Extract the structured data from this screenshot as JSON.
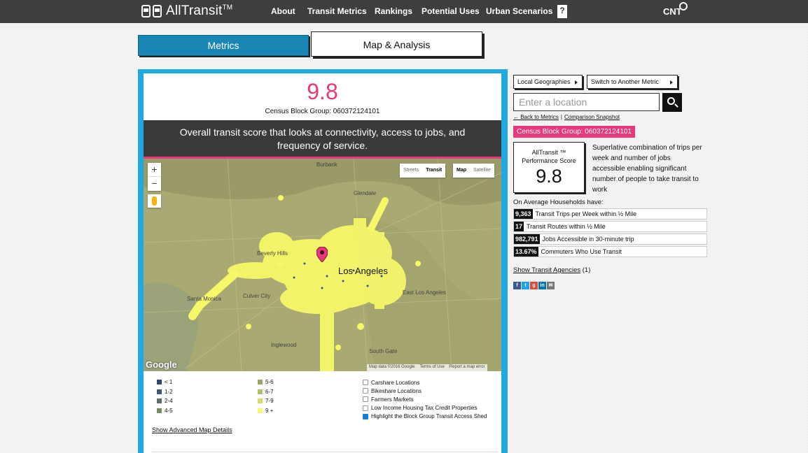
{
  "header": {
    "logo_text": "AllTransit",
    "logo_tm": "TM",
    "nav": [
      "About",
      "Transit Metrics",
      "Rankings",
      "Potential Uses",
      "Urban Scenarios"
    ],
    "help_icon": "?",
    "partner_logo": "CNT"
  },
  "tabs": {
    "metrics": "Metrics",
    "map_analysis": "Map & Analysis"
  },
  "score_panel": {
    "score": "9.8",
    "census_block_group": "Census Block Group: 060372124101",
    "description": "Overall transit score that looks at connectivity, access to jobs, and frequency of service."
  },
  "map": {
    "zoom_in": "+",
    "zoom_out": "−",
    "layer_streets": "Streets",
    "layer_transit": "Transit",
    "type_map": "Map",
    "type_satellite": "Satellite",
    "city_label": "Los Angeles",
    "place_labels": [
      "Burbank",
      "Glendale",
      "Beverly Hills",
      "Santa Monica",
      "Culver City",
      "Inglewood",
      "South Gate",
      "East Los Angeles"
    ],
    "google_logo": "Google",
    "attribution": [
      "Map data ©2016 Google",
      "Terms of Use",
      "Report a map error"
    ],
    "highlight_color": "#f7f76a",
    "base_color": "#a9a973"
  },
  "legend": {
    "left": [
      {
        "label": "< 1",
        "color": "#2d4a6e"
      },
      {
        "label": "1-2",
        "color": "#3e5a72"
      },
      {
        "label": "2-4",
        "color": "#5a6e6a"
      },
      {
        "label": "4-5",
        "color": "#7a8a63"
      }
    ],
    "right": [
      {
        "label": "5-6",
        "color": "#98a46a"
      },
      {
        "label": "6-7",
        "color": "#b4bd6c"
      },
      {
        "label": "7-9",
        "color": "#d6db6e"
      },
      {
        "label": "9 +",
        "color": "#f7f76a"
      }
    ]
  },
  "overlays": [
    {
      "label": "Carshare Locations",
      "checked": false
    },
    {
      "label": "Bikeshare Locations",
      "checked": false
    },
    {
      "label": "Farmers Markets",
      "checked": false
    },
    {
      "label": "Low Income Housing Tax Credit Properties",
      "checked": false
    },
    {
      "label": "Highlight the Block Group Transit Access Shed",
      "checked": true
    }
  ],
  "advanced_link": "Show Advanced Map Details",
  "sidebar": {
    "local_geographies": "Local Geographies",
    "switch_metric": "Switch to Another Metric",
    "search_placeholder": "Enter a location",
    "back_link": "← Back to Metrics",
    "comparison_link": "Comparison Snapshot",
    "cbg_badge": "Census Block Group: 060372124101",
    "perf_title_1": "AllTransit ™",
    "perf_title_2": "Performance Score",
    "perf_value": "9.8",
    "perf_desc": "Superlative combination of trips per week and number of jobs accessible enabling significant number of people to take transit to work",
    "avg_header": "On Average Households have:",
    "stats": [
      {
        "num": "9,363",
        "label": "Transit Trips per Week within ½ Mile"
      },
      {
        "num": "17",
        "label": "Transit Routes within ½ Mile"
      },
      {
        "num": "982,791",
        "label": "Jobs Accessible in 30-minute trip"
      },
      {
        "num": "13.67%",
        "label": "Commuters Who Use Transit"
      }
    ],
    "agencies_link": "Show Transit Agencies",
    "agencies_count": "(1)",
    "social": [
      "facebook-icon",
      "twitter-icon",
      "google-plus-icon",
      "linkedin-icon",
      "email-icon"
    ]
  }
}
